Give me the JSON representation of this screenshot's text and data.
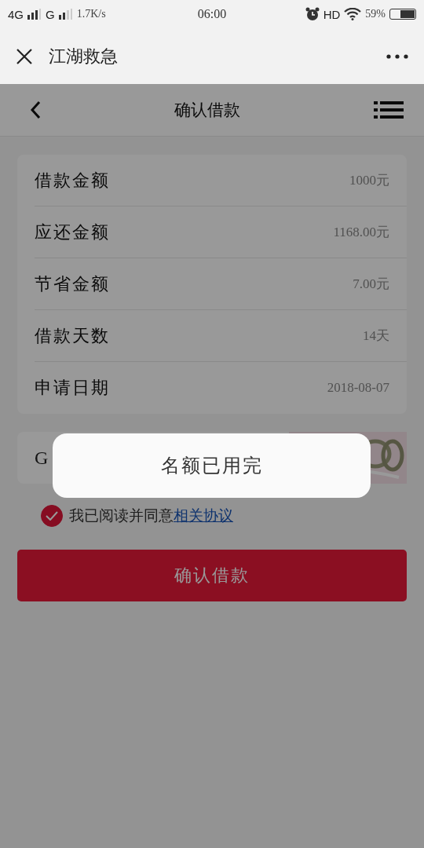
{
  "status_bar": {
    "network_1": "4G",
    "network_2": "G",
    "speed": "1.7K/s",
    "time": "06:00",
    "hd": "HD",
    "battery": "59%"
  },
  "browser_bar": {
    "title": "江湖救急"
  },
  "header": {
    "title": "确认借款"
  },
  "details": [
    {
      "label": "借款金额",
      "value": "1000元"
    },
    {
      "label": "应还金额",
      "value": "1168.00元"
    },
    {
      "label": "节省金额",
      "value": "7.00元"
    },
    {
      "label": "借款天数",
      "value": "14天"
    },
    {
      "label": "申请日期",
      "value": "2018-08-07"
    }
  ],
  "captcha": {
    "value": "G",
    "kind": "picture"
  },
  "agreement": {
    "checked": true,
    "text": "我已阅读并同意",
    "link": "相关协议"
  },
  "confirm_button": "确认借款",
  "toast": {
    "message": "名额已用完"
  }
}
